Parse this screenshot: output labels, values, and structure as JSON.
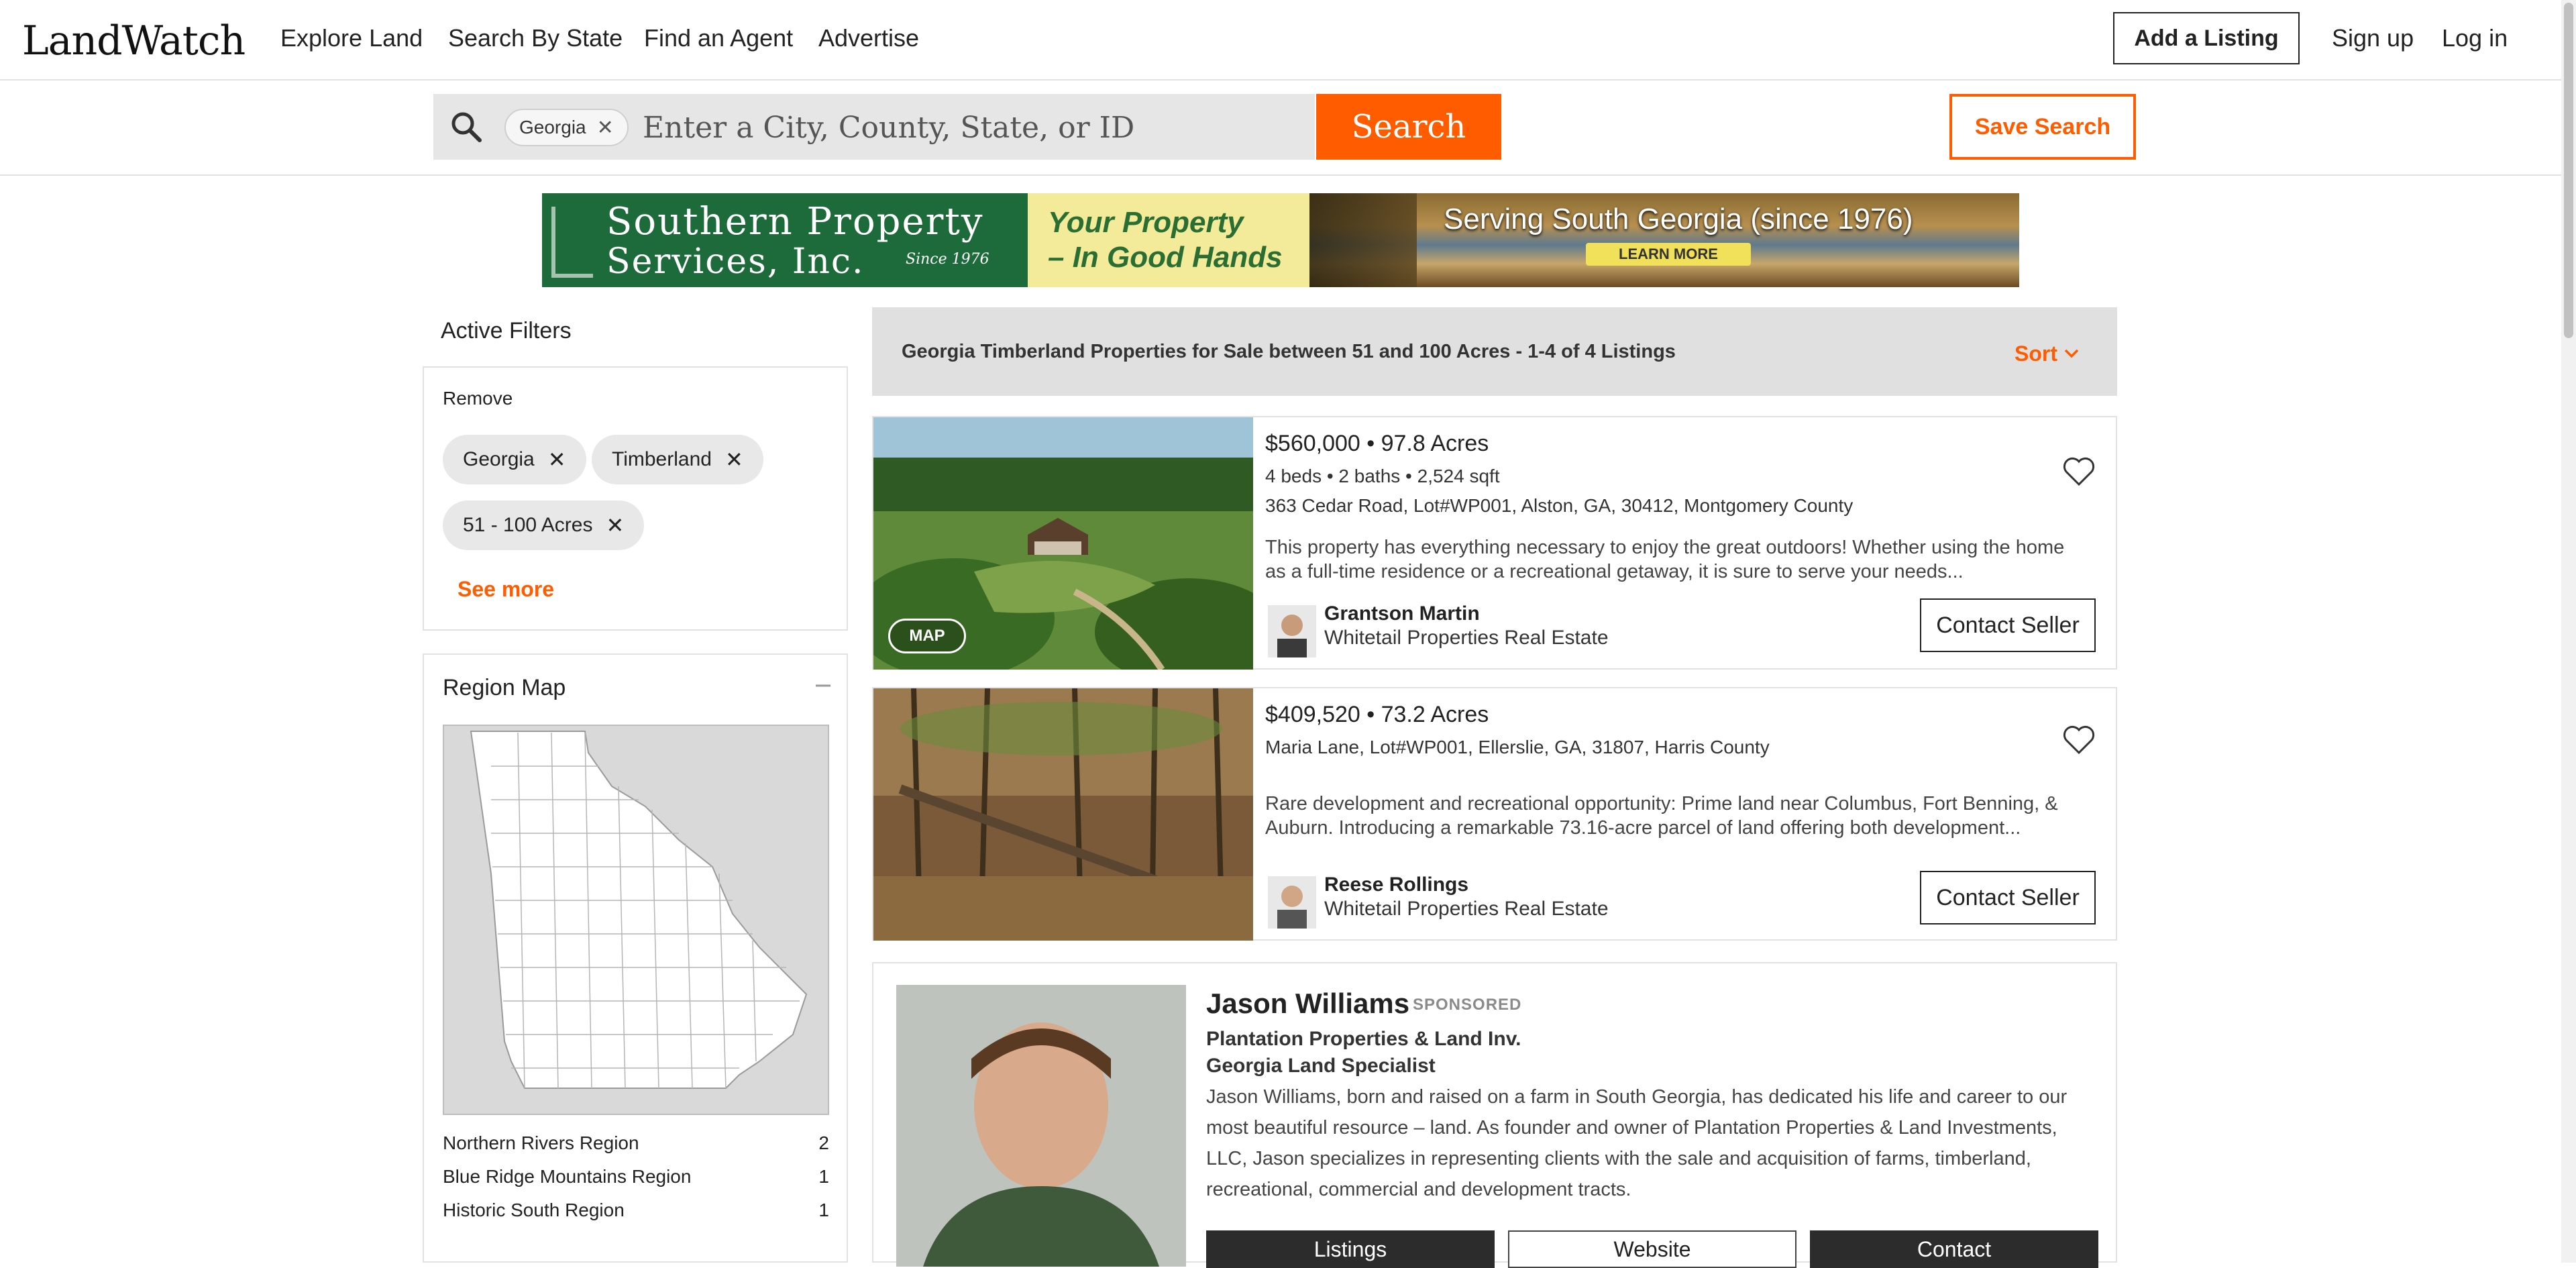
{
  "header": {
    "logo": "LandWatch",
    "nav": [
      "Explore Land",
      "Search By State",
      "Find an Agent",
      "Advertise"
    ],
    "add_listing": "Add a Listing",
    "sign_up": "Sign up",
    "log_in": "Log in"
  },
  "search": {
    "chip": "Georgia",
    "placeholder": "Enter a City, County, State, or ID",
    "button": "Search",
    "save": "Save Search"
  },
  "banner": {
    "line1": "Southern Property",
    "line2": "Services, Inc.",
    "since": "Since 1976",
    "tagline1": "Your Property",
    "tagline2": "– In Good Hands",
    "serving": "Serving South Georgia (since 1976)",
    "learn_more": "LEARN MORE"
  },
  "sidebar": {
    "active_filters_title": "Active Filters",
    "remove_label": "Remove",
    "filters": [
      "Georgia",
      "Timberland",
      "51 - 100 Acres"
    ],
    "see_more": "See more",
    "region_title": "Region Map",
    "regions": [
      {
        "name": "Northern Rivers Region",
        "count": "2"
      },
      {
        "name": "Blue Ridge Mountains Region",
        "count": "1"
      },
      {
        "name": "Historic South Region",
        "count": "1"
      }
    ]
  },
  "results": {
    "title": "Georgia Timberland Properties for Sale between 51 and 100 Acres - 1-4 of 4 Listings",
    "sort": "Sort",
    "listings": [
      {
        "price_acres": "$560,000 • 97.8 Acres",
        "specs": "4 beds • 2 baths • 2,524 sqft",
        "address": "363 Cedar Road, Lot#WP001, Alston, GA, 30412, Montgomery County",
        "description": "This property has everything necessary to enjoy the great outdoors! Whether using the home as a full-time residence or a recreational getaway, it is sure to serve your needs...",
        "agent_name": "Grantson Martin",
        "agent_company": "Whitetail Properties Real Estate",
        "contact": "Contact Seller",
        "map": "MAP"
      },
      {
        "price_acres": "$409,520 • 73.2 Acres",
        "address": "Maria Lane, Lot#WP001, Ellerslie, GA, 31807, Harris County",
        "description": "Rare development and recreational opportunity: Prime land near Columbus, Fort Benning, & Auburn. Introducing a remarkable 73.16-acre parcel of land offering both development...",
        "agent_name": "Reese Rollings",
        "agent_company": "Whitetail Properties Real Estate",
        "contact": "Contact Seller"
      }
    ]
  },
  "sponsored": {
    "name": "Jason Williams",
    "tag": "SPONSORED",
    "company": "Plantation Properties & Land Inv.",
    "role": "Georgia Land Specialist",
    "bio": "Jason Williams, born and raised on a farm in South Georgia, has dedicated his life and career to our most beautiful resource – land. As founder and owner of Plantation Properties & Land Investments, LLC, Jason specializes in representing clients with the sale and acquisition of farms, timberland, recreational, commercial and development tracts.",
    "buttons": [
      "Listings",
      "Website",
      "Contact"
    ]
  },
  "colors": {
    "accent": "#ff5c00",
    "banner_green": "#1d6b3a"
  }
}
